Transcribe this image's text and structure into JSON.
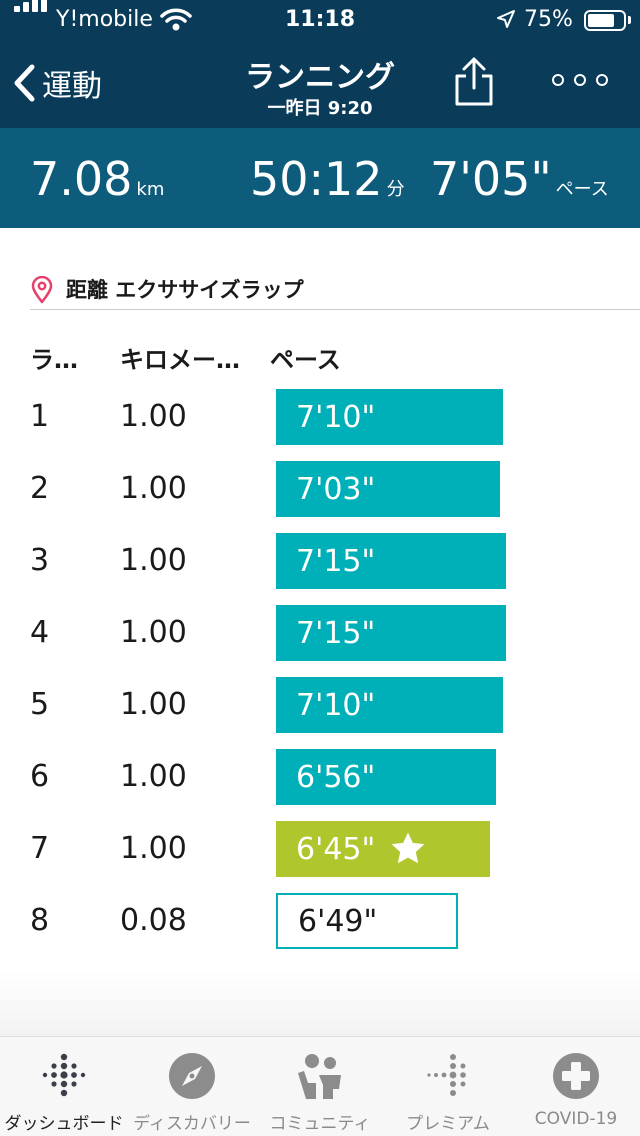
{
  "status_bar": {
    "carrier": "Y!mobile",
    "time": "11:18",
    "battery_pct": "75%",
    "battery_level": 0.75
  },
  "nav": {
    "back_label": "運動",
    "title": "ランニング",
    "subtitle": "一昨日 9:20"
  },
  "summary": {
    "distance": {
      "value": "7.08",
      "unit": "km"
    },
    "duration": {
      "value": "50:12",
      "unit": "分"
    },
    "pace": {
      "value": "7'05\"",
      "unit": "ペース"
    }
  },
  "section": {
    "title": "距離 エクササイズラップ"
  },
  "table": {
    "headers": {
      "lap": "ラ…",
      "km": "キロメー…",
      "pace": "ペース"
    },
    "max_pace_seconds": 435,
    "rows": [
      {
        "lap": "1",
        "km": "1.00",
        "pace": "7'10\"",
        "pace_seconds": 430,
        "status": "normal"
      },
      {
        "lap": "2",
        "km": "1.00",
        "pace": "7'03\"",
        "pace_seconds": 423,
        "status": "normal"
      },
      {
        "lap": "3",
        "km": "1.00",
        "pace": "7'15\"",
        "pace_seconds": 435,
        "status": "normal"
      },
      {
        "lap": "4",
        "km": "1.00",
        "pace": "7'15\"",
        "pace_seconds": 435,
        "status": "normal"
      },
      {
        "lap": "5",
        "km": "1.00",
        "pace": "7'10\"",
        "pace_seconds": 430,
        "status": "normal"
      },
      {
        "lap": "6",
        "km": "1.00",
        "pace": "6'56\"",
        "pace_seconds": 416,
        "status": "normal"
      },
      {
        "lap": "7",
        "km": "1.00",
        "pace": "6'45\"",
        "pace_seconds": 405,
        "status": "best"
      },
      {
        "lap": "8",
        "km": "0.08",
        "pace": "6'49\"",
        "pace_seconds": 409,
        "status": "partial"
      }
    ]
  },
  "tabs": [
    {
      "label": "ダッシュボード",
      "icon": "dashboard-dots-icon",
      "active": true
    },
    {
      "label": "ディスカバリー",
      "icon": "compass-icon",
      "active": false
    },
    {
      "label": "コミュニティ",
      "icon": "community-icon",
      "active": false
    },
    {
      "label": "プレミアム",
      "icon": "premium-dots-icon",
      "active": false
    },
    {
      "label": "COVID-19",
      "icon": "plus-circle-icon",
      "active": false
    }
  ],
  "colors": {
    "header": "#0a3c5a",
    "summary": "#0e5c7b",
    "bar": "#00b0b9",
    "best_bar": "#b1c52c",
    "location_pin": "#e6416a"
  }
}
